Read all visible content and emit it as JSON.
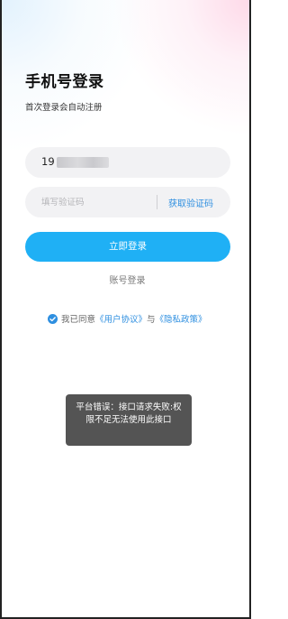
{
  "header": {
    "title": "手机号登录",
    "subtitle": "首次登录会自动注册"
  },
  "phone": {
    "value_visible": "19",
    "masked": true
  },
  "code": {
    "placeholder": "填写验证码",
    "value": "",
    "get_code_label": "获取验证码"
  },
  "actions": {
    "login_label": "立即登录",
    "account_login_label": "账号登录"
  },
  "agreement": {
    "checked": true,
    "prefix": "我已同意",
    "user_agreement": "《用户协议》",
    "joiner": "与",
    "privacy_policy": "《隐私政策》"
  },
  "toast": {
    "message": "平台错误：接口请求失败:权限不足无法使用此接口"
  },
  "colors": {
    "accent": "#1fb0f5",
    "link": "#2e8fe0",
    "title": "#111111",
    "input_bg": "#f2f2f4",
    "toast_bg": "#4b4b4b"
  }
}
